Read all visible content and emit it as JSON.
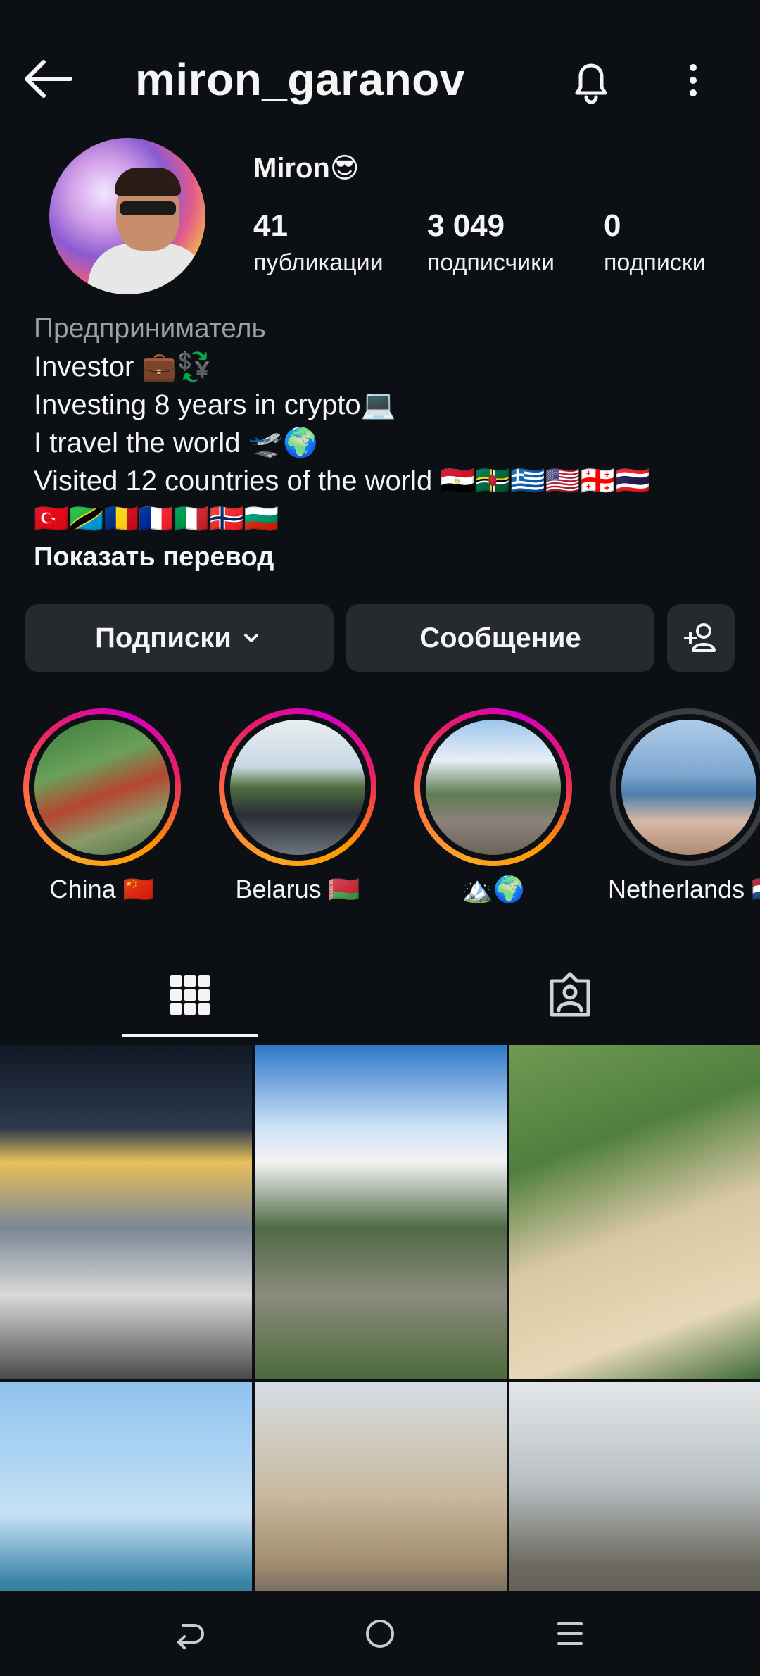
{
  "header": {
    "username": "miron_garanov"
  },
  "profile": {
    "display_name": "Miron😎",
    "stats": [
      {
        "value": "41",
        "label": "публикации"
      },
      {
        "value": "3 049",
        "label": "подписчики"
      },
      {
        "value": "0",
        "label": "подписки"
      }
    ]
  },
  "bio": {
    "category": "Предприниматель",
    "lines": [
      "Investor 💼💱",
      "Investing 8 years in crypto💻",
      "I travel the world 🛫🌍",
      "Visited 12 countries of the world 🇪🇬🇩🇲🇬🇷🇺🇸🇬🇪🇹🇭",
      "🇹🇷🇹🇿🇷🇴🇫🇷🇮🇹🇳🇴🇧🇬"
    ],
    "translate_link": "Показать перевод"
  },
  "actions": {
    "following_label": "Подписки",
    "message_label": "Сообщение"
  },
  "highlights": [
    {
      "title": "China 🇨🇳",
      "seen": false
    },
    {
      "title": "Belarus 🇧🇾",
      "seen": false
    },
    {
      "title": "🏔️🌍",
      "seen": false
    },
    {
      "title": "Netherlands 🇳🇱",
      "seen": true
    }
  ],
  "icons": {
    "back": "arrow-left-icon",
    "notifications": "bell-icon",
    "more": "more-vertical-icon",
    "add_user": "add-person-icon",
    "grid": "grid-icon",
    "tagged": "tagged-person-icon"
  },
  "colors": {
    "background": "#0c1014",
    "button": "#26292e",
    "secondary_text": "#9aa0a6",
    "story_ring_start": "#f9a825",
    "story_ring_end": "#d400c6"
  }
}
